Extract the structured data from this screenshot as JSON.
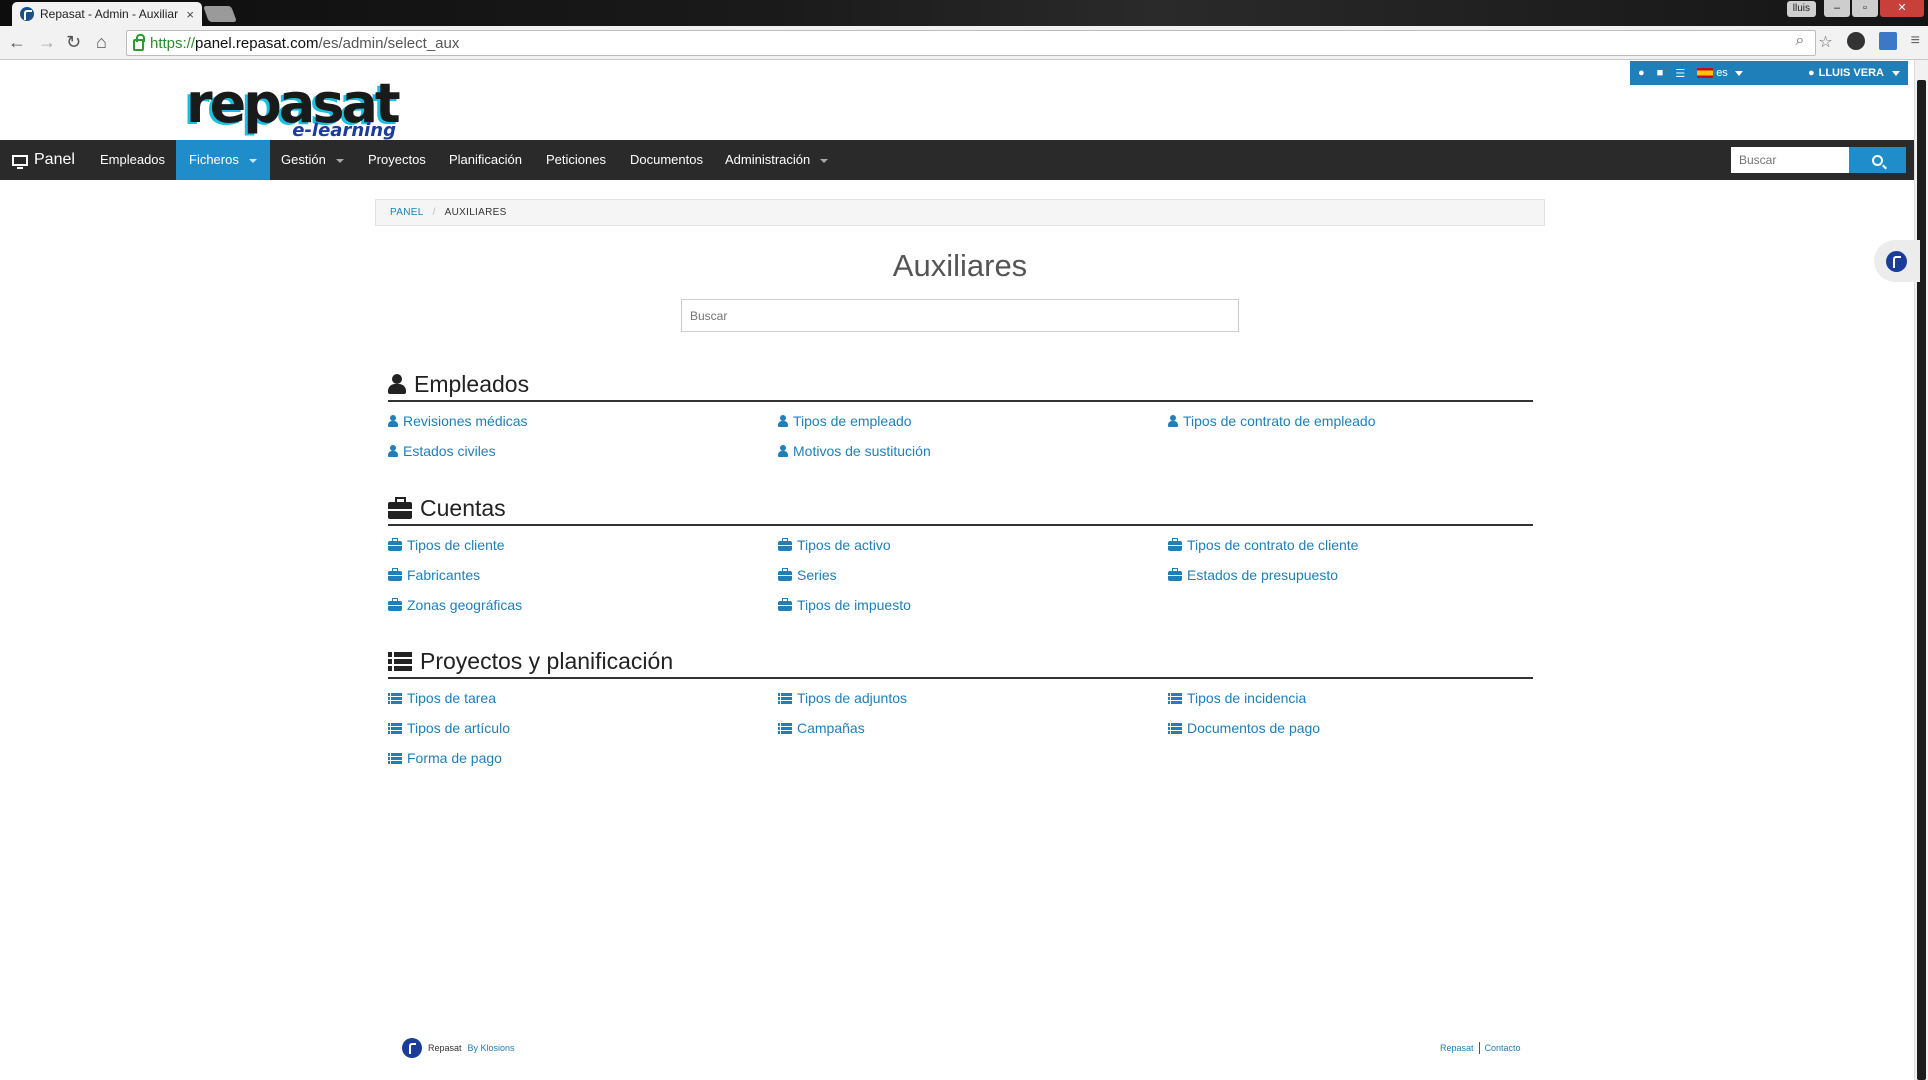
{
  "browser": {
    "tab_title": "Repasat - Admin - Auxiliar",
    "tab_close": "×",
    "profile_name": "lluis",
    "url_scheme": "https://",
    "url_host": "panel.repasat.com",
    "url_path": "/es/admin/select_aux"
  },
  "utilbar": {
    "lang": "es",
    "user": "LLUIS VERA"
  },
  "logo": {
    "word": "repasat",
    "tagline": "e-learning"
  },
  "nav": {
    "brand": "Panel",
    "items": [
      "Empleados",
      "Ficheros",
      "Gestión",
      "Proyectos",
      "Planificación",
      "Peticiones",
      "Documentos",
      "Administración"
    ],
    "active": "Ficheros",
    "search_placeholder": "Buscar"
  },
  "breadcrumb": {
    "home": "PANEL",
    "current": "AUXILIARES"
  },
  "page": {
    "title": "Auxiliares",
    "filter_placeholder": "Buscar"
  },
  "sections": [
    {
      "title": "Empleados",
      "icon": "user-icon",
      "items": [
        "Revisiones médicas",
        "Tipos de empleado",
        "Tipos de contrato de empleado",
        "Estados civiles",
        "Motivos de sustitución"
      ]
    },
    {
      "title": "Cuentas",
      "icon": "briefcase-icon",
      "items": [
        "Tipos de cliente",
        "Tipos de activo",
        "Tipos de contrato de cliente",
        "Fabricantes",
        "Series",
        "Estados de presupuesto",
        "Zonas geográficas",
        "Tipos de impuesto"
      ]
    },
    {
      "title": "Proyectos y planificación",
      "icon": "tasks-icon",
      "items": [
        "Tipos de tarea",
        "Tipos de adjuntos",
        "Tipos de incidencia",
        "Tipos de artículo",
        "Campañas",
        "Documentos de pago",
        "Forma de pago"
      ]
    }
  ],
  "footer": {
    "brand": "Repasat",
    "by": "By Klosions",
    "links": [
      "Repasat",
      "Contacto"
    ]
  },
  "colors": {
    "accent": "#1f8dc9",
    "link": "#1f7fb8",
    "navbar": "#2a2a2a"
  }
}
